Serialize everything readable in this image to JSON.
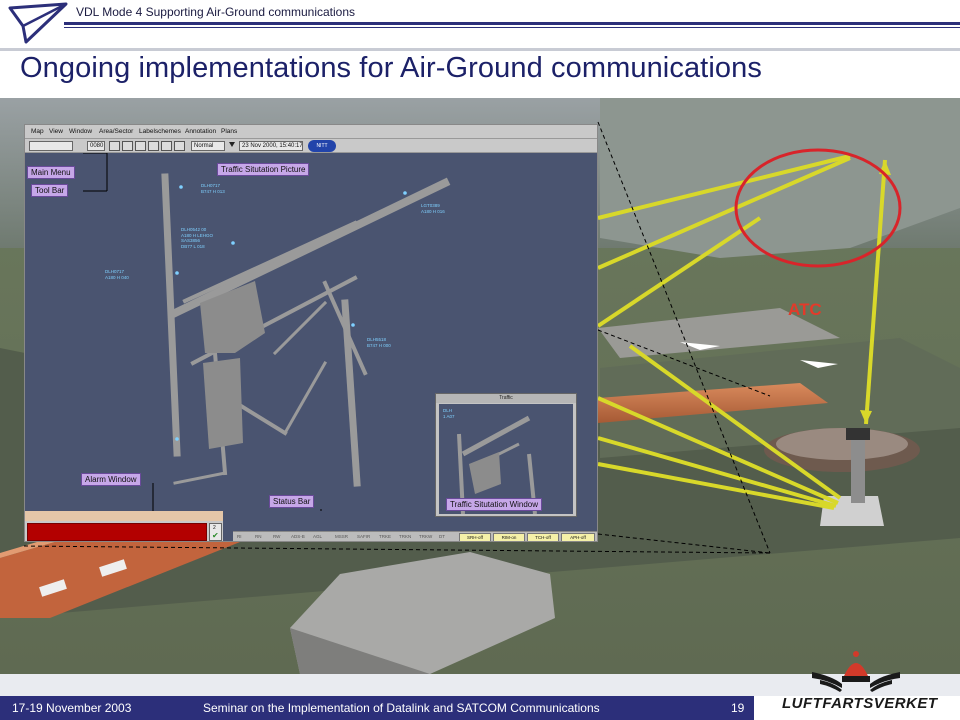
{
  "header": {
    "topic": "VDL Mode 4 Supporting Air-Ground communications",
    "title": "Ongoing implementations for Air-Ground communications"
  },
  "scene": {
    "atc_label": "ATC"
  },
  "atc_screen": {
    "menu": [
      "Map",
      "View",
      "Window",
      "Area/Sector",
      "Labelschemes",
      "Annotation",
      "Plans"
    ],
    "toolbar": {
      "range_value": "0080",
      "mode_value": "Normal",
      "datetime": "23 Nov 2000, 15:40:17",
      "badge": "NITT"
    },
    "callouts": {
      "main_menu": "Main Menu",
      "tool_bar": "Tool Bar",
      "traffic_picture": "Traffic Situtation Picture",
      "alarm_window": "Alarm Window",
      "status_bar": "Status Bar",
      "traffic_window": "Traffic Situtation Window"
    },
    "aircraft_labels": [
      "DLH0717\nB747 H 013",
      "DLH0542 00\nA180 H LEHGO\nSAS3856\nDB77 L 018",
      "LGT0389\nA180 H 016",
      "DLH0717\nA180 H 040",
      "DLH5518\nB747 H 000"
    ],
    "alarm_count": "2",
    "traffic_window_title": "Traffic",
    "traffic_window_label": "DLH\n1 A07",
    "status_bar_items": [
      "RI",
      "RN",
      "RW",
      "ADS-B",
      "AGL",
      "MSSR",
      "SAFIR",
      "TRKE",
      "TRKN",
      "TRKW",
      "DT"
    ],
    "status_toggles": [
      "SRH-off",
      "RIM-on",
      "TCH-off",
      "APH-off"
    ]
  },
  "footer": {
    "date": "17-19 November 2003",
    "seminar": "Seminar on the Implementation of Datalink and SATCOM Communications",
    "page": "19",
    "agency": "LUFTFARTSVERKET"
  },
  "colors": {
    "brand_navy": "#2c2f7a",
    "title_blue": "#1c2168",
    "atc_red": "#e33a2a",
    "link_yellow": "#d8d82a",
    "screen_bg": "#4a5470",
    "callout_purple": "#c6a7e8"
  }
}
